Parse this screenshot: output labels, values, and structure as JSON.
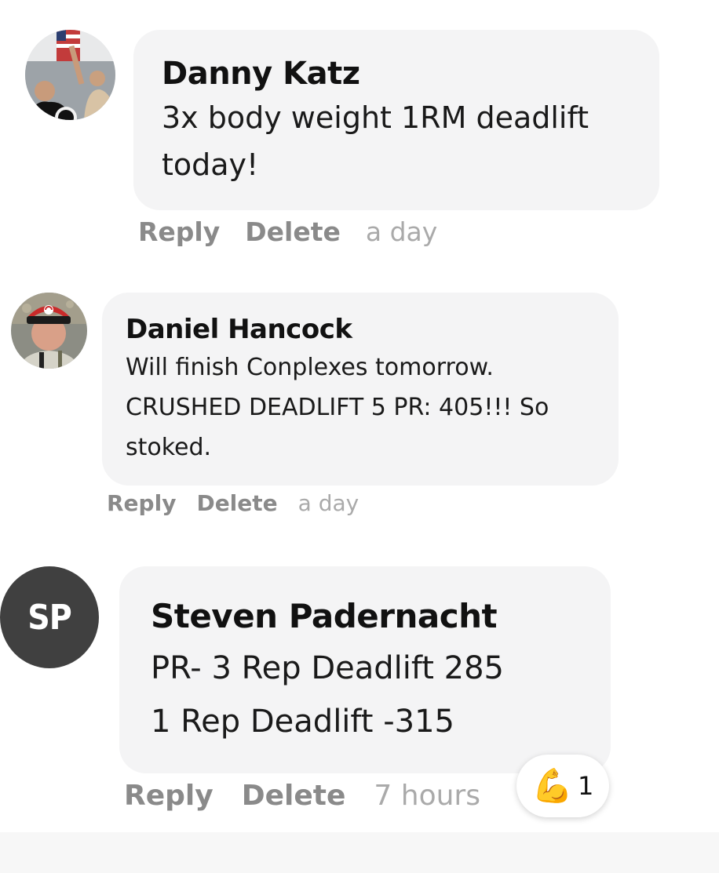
{
  "comments": [
    {
      "author": "Danny Katz",
      "text": "3x body weight 1RM deadlift\ntoday!",
      "actions": {
        "reply": "Reply",
        "delete": "Delete"
      },
      "time": "a day",
      "avatar_icon": "user-photo"
    },
    {
      "author": "Daniel Hancock",
      "text": "Will finish Conplexes tomorrow.\nCRUSHED DEADLIFT 5 PR: 405!!! So\nstoked.",
      "actions": {
        "reply": "Reply",
        "delete": "Delete"
      },
      "time": "a day",
      "avatar_icon": "user-photo"
    },
    {
      "author": "Steven Padernacht",
      "text": "PR- 3 Rep Deadlift 285\n1 Rep Deadlift -315",
      "actions": {
        "reply": "Reply",
        "delete": "Delete"
      },
      "time": "7 hours",
      "avatar_initials": "SP",
      "reaction": {
        "emoji": "💪",
        "emoji_name": "flexed-biceps",
        "count": "1"
      }
    }
  ],
  "colors": {
    "bubble": "#f4f4f5",
    "action_text": "#8a8a8a",
    "time_text": "#aaaaaa",
    "initials_avatar": "#404040"
  }
}
